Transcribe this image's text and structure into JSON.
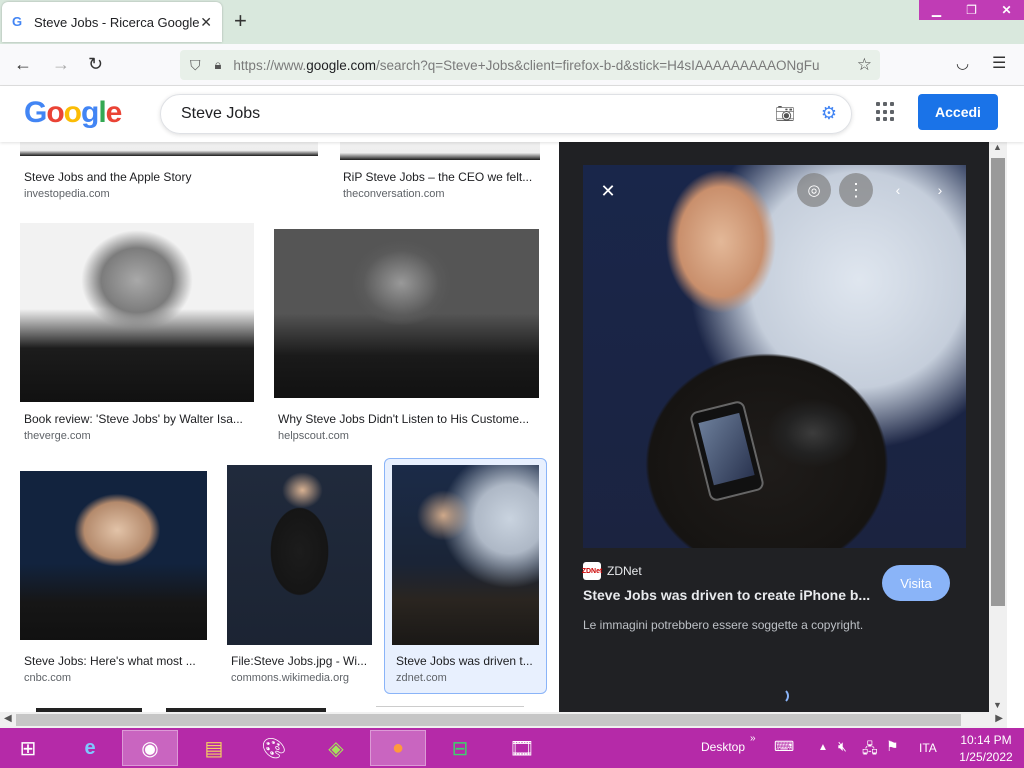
{
  "browser": {
    "tab_title": "Steve Jobs - Ricerca Google",
    "tab_favicon": "G",
    "url_prefix": "https://www.",
    "url_host": "google.com",
    "url_rest": "/search?q=Steve+Jobs&client=firefox-b-d&stick=H4sIAAAAAAAAAONgFu"
  },
  "google": {
    "logo": "Google",
    "query": "Steve Jobs",
    "signin_label": "Accedi"
  },
  "results": [
    {
      "title": "Steve Jobs and the Apple Story",
      "source": "investopedia.com"
    },
    {
      "title": "RiP Steve Jobs – the CEO we felt...",
      "source": "theconversation.com"
    },
    {
      "title": "Book review: 'Steve Jobs' by Walter Isa...",
      "source": "theverge.com"
    },
    {
      "title": "Why Steve Jobs Didn't Listen to His Custome...",
      "source": "helpscout.com"
    },
    {
      "title": "Steve Jobs: Here's what most ...",
      "source": "cnbc.com"
    },
    {
      "title": "File:Steve Jobs.jpg - Wi...",
      "source": "commons.wikimedia.org"
    },
    {
      "title": "Steve Jobs was driven t...",
      "source": "zdnet.com"
    }
  ],
  "preview": {
    "source_name": "ZDNet",
    "source_icon_text": "ZDNet",
    "title": "Steve Jobs was driven to create iPhone b...",
    "visit_label": "Visita",
    "copyright_note": "Le immagini potrebbero essere soggette a copyright."
  },
  "taskbar": {
    "desktop_label": "Desktop",
    "language": "ITA",
    "time": "10:14 PM",
    "date": "1/25/2022"
  },
  "colors": {
    "accent": "#1a73e8",
    "taskbar": "#b52aa8",
    "preview_bg": "#202124"
  }
}
